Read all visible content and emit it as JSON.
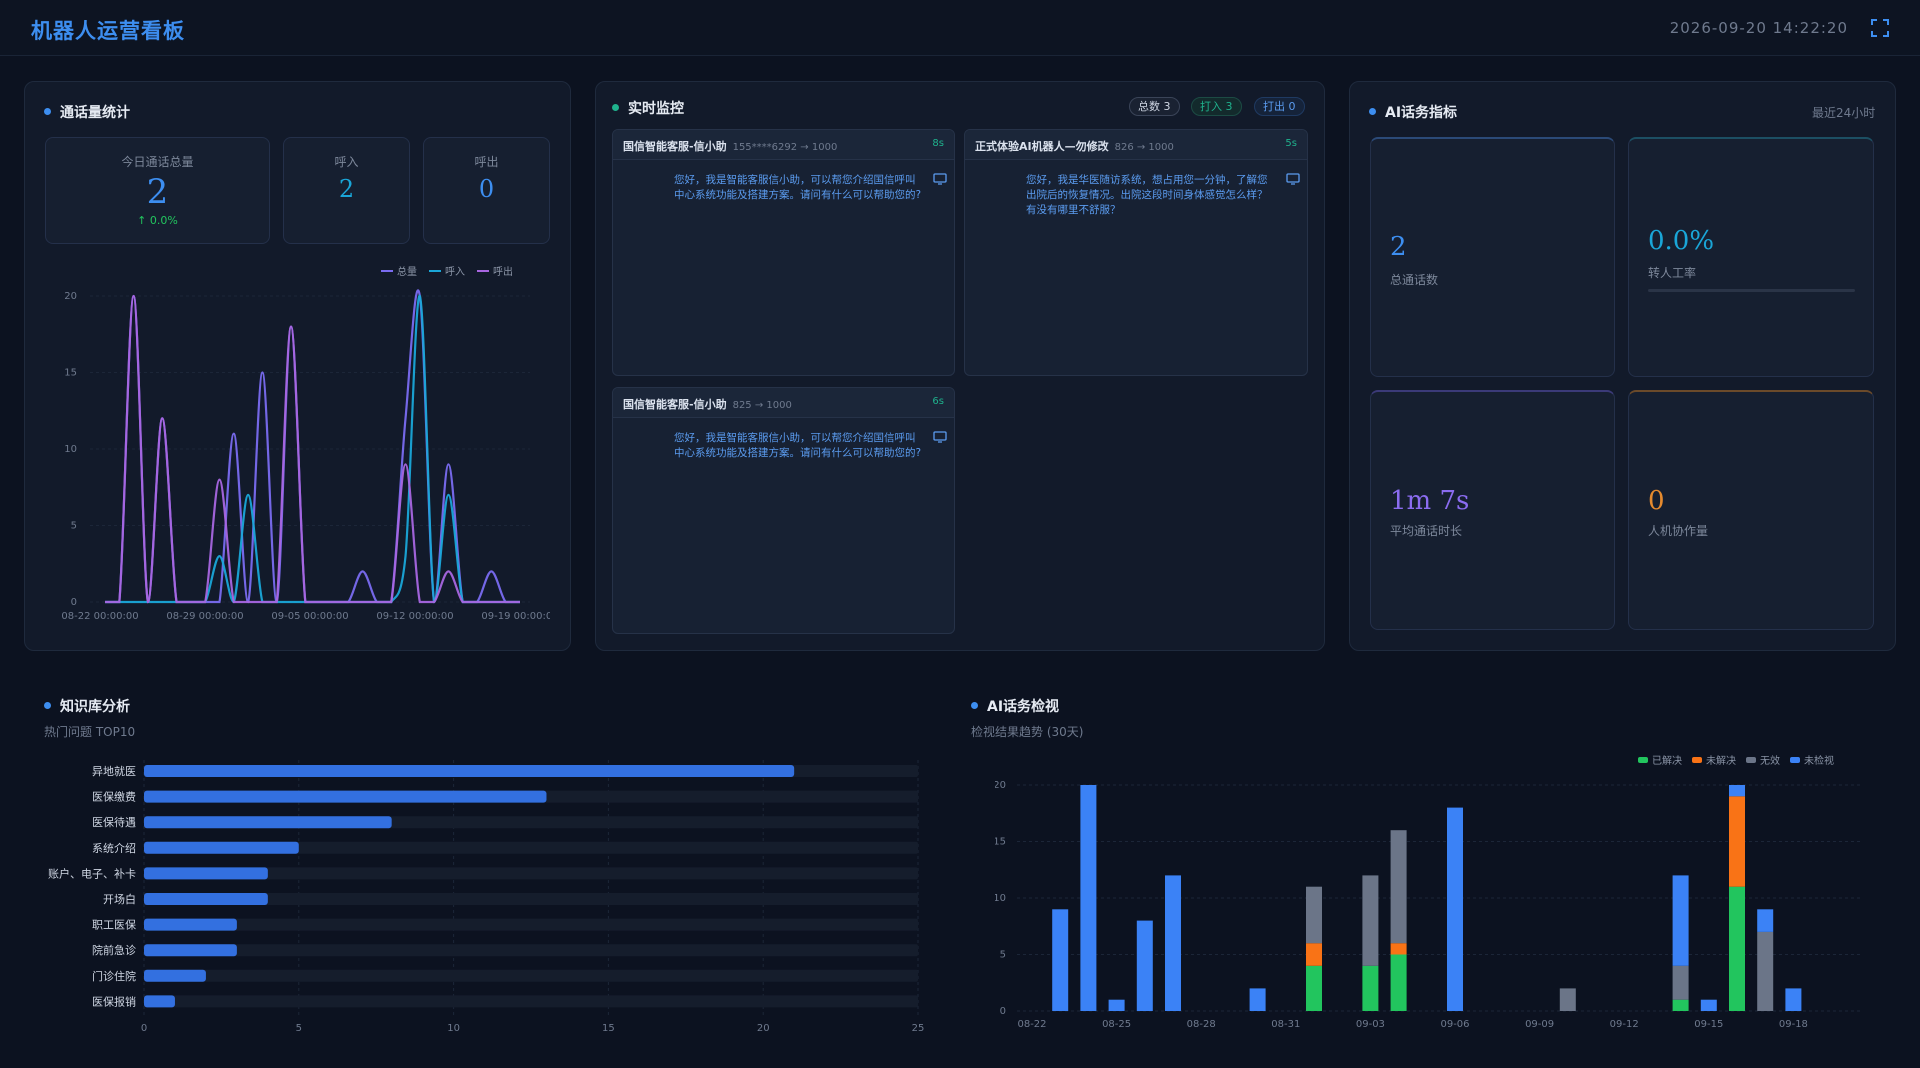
{
  "header": {
    "title": "机器人运营看板",
    "datetime": "2026-09-20 14:22:20",
    "fullscreen_icon": "fullscreen-icon"
  },
  "calls": {
    "title": "通话量统计",
    "today_label": "今日通话总量",
    "today_value": "2",
    "today_delta": "↑ 0.0%",
    "in_label": "呼入",
    "in_value": "2",
    "out_label": "呼出",
    "out_value": "0",
    "legend": [
      "总量",
      "呼入",
      "呼出"
    ],
    "colors": {
      "total": "#7a6cf0",
      "in": "#1aa6d8",
      "out": "#a866e0"
    }
  },
  "monitor": {
    "title": "实时监控",
    "badges": {
      "total": "总数 3",
      "in": "打入 3",
      "out": "打出 0"
    },
    "cards": [
      {
        "name": "国信智能客服-信小助",
        "phone": "155****6292 → 1000",
        "dur": "8s",
        "text": "您好，我是智能客服信小助，可以帮您介绍国信呼叫中心系统功能及搭建方案。请问有什么可以帮助您的?"
      },
      {
        "name": "正式体验AI机器人—勿修改",
        "phone": "826 → 1000",
        "dur": "5s",
        "text": "您好，我是华医随访系统，想占用您一分钟，了解您出院后的恢复情况。出院这段时间身体感觉怎么样？有没有哪里不舒服？"
      },
      {
        "name": "国信智能客服-信小助",
        "phone": "825 → 1000",
        "dur": "6s",
        "text": "您好，我是智能客服信小助，可以帮您介绍国信呼叫中心系统功能及搭建方案。请问有什么可以帮助您的?"
      }
    ]
  },
  "ai_metrics": {
    "title": "AI话务指标",
    "range": "最近24小时",
    "items": [
      {
        "value": "2",
        "label": "总通话数",
        "color": "#3d8ef0"
      },
      {
        "value": "0.0%",
        "label": "转人工率",
        "color": "#1aa6d8",
        "progress": 0
      },
      {
        "value": "1m 7s",
        "label": "平均通话时长",
        "color": "#8b6cf0"
      },
      {
        "value": "0",
        "label": "人机协作量",
        "color": "#e58a2e"
      }
    ]
  },
  "knowledge": {
    "title": "知识库分析",
    "subtitle": "热门问题 TOP10"
  },
  "inspection": {
    "title": "AI话务检视",
    "subtitle": "检视结果趋势 (30天)",
    "legend": [
      "已解决",
      "未解决",
      "无效",
      "未检视"
    ],
    "colors": [
      "#22c55e",
      "#f97316",
      "#6b7588",
      "#3b82f6"
    ]
  },
  "chart_data": [
    {
      "type": "line",
      "x_ticks": [
        "08-22 00:00:00",
        "08-29 00:00:00",
        "09-05 00:00:00",
        "09-12 00:00:00",
        "09-19 00:00:00"
      ],
      "ylim": [
        0,
        20
      ],
      "y_ticks": [
        0,
        5,
        10,
        15,
        20
      ],
      "series": [
        {
          "name": "总量",
          "values": [
            0,
            0,
            20,
            0,
            12,
            0,
            0,
            0,
            0,
            11,
            0,
            15,
            0,
            18,
            0,
            0,
            0,
            0,
            2,
            0,
            0,
            12,
            20,
            0,
            9,
            0,
            0,
            2,
            0,
            0
          ]
        },
        {
          "name": "呼入",
          "values": [
            0,
            0,
            0,
            0,
            0,
            0,
            0,
            0,
            3,
            0,
            7,
            0,
            0,
            0,
            0,
            0,
            0,
            0,
            0,
            0,
            0,
            3,
            20,
            0,
            7,
            0,
            0,
            0,
            0,
            0
          ]
        },
        {
          "name": "呼出",
          "values": [
            0,
            0,
            20,
            0,
            12,
            0,
            0,
            0,
            8,
            0,
            0,
            0,
            0,
            18,
            0,
            0,
            0,
            0,
            0,
            0,
            0,
            9,
            0,
            0,
            2,
            0,
            0,
            0,
            0,
            0
          ]
        }
      ]
    },
    {
      "type": "bar",
      "orientation": "horizontal",
      "categories": [
        "异地就医",
        "医保缴费",
        "医保待遇",
        "系统介绍",
        "账户、电子、补卡",
        "开场白",
        "职工医保",
        "院前急诊",
        "门诊住院",
        "医保报销"
      ],
      "values": [
        21,
        13,
        8,
        5,
        4,
        4,
        3,
        3,
        2,
        1
      ],
      "xlim": [
        0,
        25
      ],
      "x_ticks": [
        0,
        5,
        10,
        15,
        20,
        25
      ]
    },
    {
      "type": "bar",
      "stacked": true,
      "x_ticks": [
        "08-22",
        "08-25",
        "08-28",
        "08-31",
        "09-03",
        "09-06",
        "09-09",
        "09-12",
        "09-15",
        "09-18"
      ],
      "ylim": [
        0,
        20
      ],
      "y_ticks": [
        0,
        5,
        10,
        15,
        20
      ],
      "series": [
        {
          "name": "已解决",
          "values": [
            0,
            0,
            0,
            0,
            0,
            0,
            0,
            0,
            0,
            0,
            4,
            0,
            4,
            5,
            0,
            0,
            0,
            0,
            0,
            0,
            0,
            0,
            0,
            1,
            0,
            11,
            0,
            0
          ]
        },
        {
          "name": "未解决",
          "values": [
            0,
            0,
            0,
            0,
            0,
            0,
            0,
            0,
            0,
            0,
            2,
            0,
            0,
            1,
            0,
            0,
            0,
            0,
            0,
            0,
            0,
            0,
            0,
            0,
            0,
            8,
            0,
            0
          ]
        },
        {
          "name": "无效",
          "values": [
            0,
            0,
            0,
            0,
            0,
            0,
            0,
            0,
            0,
            0,
            5,
            0,
            8,
            10,
            0,
            0,
            0,
            0,
            0,
            2,
            0,
            0,
            0,
            3,
            0,
            0,
            7,
            0
          ]
        },
        {
          "name": "未检视",
          "values": [
            0,
            9,
            20,
            1,
            8,
            12,
            0,
            0,
            2,
            0,
            0,
            0,
            0,
            0,
            0,
            18,
            0,
            0,
            0,
            0,
            0,
            0,
            0,
            8,
            1,
            1,
            2,
            2
          ]
        }
      ]
    }
  ]
}
